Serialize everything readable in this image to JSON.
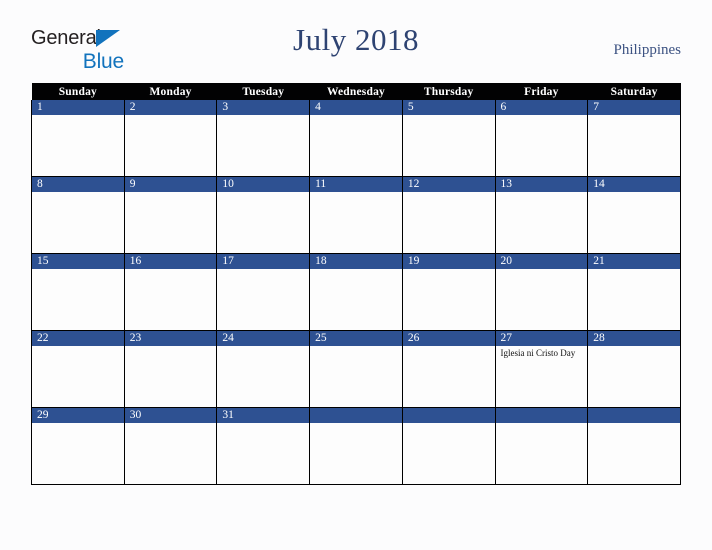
{
  "logo": {
    "part1": "General",
    "part2": "Blue",
    "triangle_color": "#1273bd",
    "text_color": "#231f20"
  },
  "header": {
    "title": "July 2018",
    "country": "Philippines",
    "title_color": "#2e4372"
  },
  "colors": {
    "header_row_bg": "#020203",
    "day_band_bg": "#2e5192",
    "page_bg": "#fcfcfd",
    "cell_bg": "#fdfdfd",
    "border": "#000000"
  },
  "weekday_headers": [
    "Sunday",
    "Monday",
    "Tuesday",
    "Wednesday",
    "Thursday",
    "Friday",
    "Saturday"
  ],
  "weeks": [
    [
      {
        "day": "1",
        "events": []
      },
      {
        "day": "2",
        "events": []
      },
      {
        "day": "3",
        "events": []
      },
      {
        "day": "4",
        "events": []
      },
      {
        "day": "5",
        "events": []
      },
      {
        "day": "6",
        "events": []
      },
      {
        "day": "7",
        "events": []
      }
    ],
    [
      {
        "day": "8",
        "events": []
      },
      {
        "day": "9",
        "events": []
      },
      {
        "day": "10",
        "events": []
      },
      {
        "day": "11",
        "events": []
      },
      {
        "day": "12",
        "events": []
      },
      {
        "day": "13",
        "events": []
      },
      {
        "day": "14",
        "events": []
      }
    ],
    [
      {
        "day": "15",
        "events": []
      },
      {
        "day": "16",
        "events": []
      },
      {
        "day": "17",
        "events": []
      },
      {
        "day": "18",
        "events": []
      },
      {
        "day": "19",
        "events": []
      },
      {
        "day": "20",
        "events": []
      },
      {
        "day": "21",
        "events": []
      }
    ],
    [
      {
        "day": "22",
        "events": []
      },
      {
        "day": "23",
        "events": []
      },
      {
        "day": "24",
        "events": []
      },
      {
        "day": "25",
        "events": []
      },
      {
        "day": "26",
        "events": []
      },
      {
        "day": "27",
        "events": [
          "Iglesia ni Cristo Day"
        ]
      },
      {
        "day": "28",
        "events": []
      }
    ],
    [
      {
        "day": "29",
        "events": []
      },
      {
        "day": "30",
        "events": []
      },
      {
        "day": "31",
        "events": []
      },
      {
        "day": "",
        "events": []
      },
      {
        "day": "",
        "events": []
      },
      {
        "day": "",
        "events": []
      },
      {
        "day": "",
        "events": []
      }
    ]
  ]
}
